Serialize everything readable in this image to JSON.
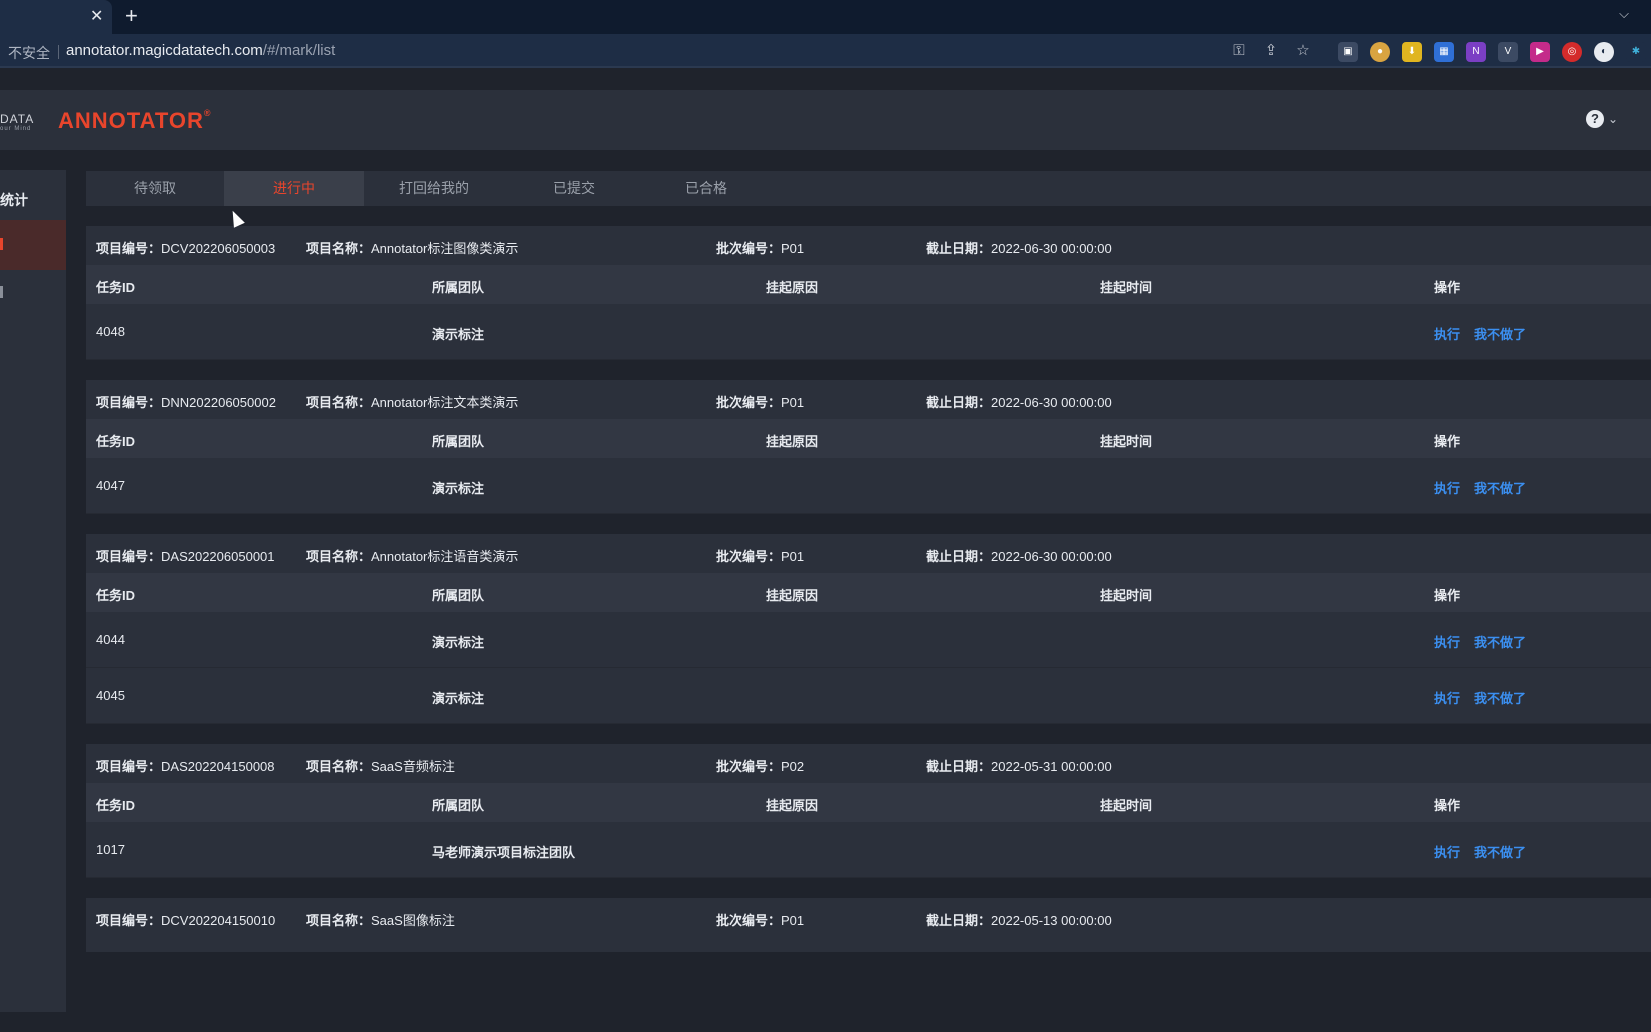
{
  "browser": {
    "insecure_label": "不安全",
    "url_host": "annotator.magicdatatech.com",
    "url_path": "/#/mark/list"
  },
  "header": {
    "logo_data": "DATA",
    "logo_sub": "our Mind",
    "logo_text": "ANNOTATOR",
    "logo_mark": "®",
    "help_label": "?"
  },
  "sidebar": {
    "stat_label": "统计"
  },
  "tabs": [
    {
      "label": "待领取"
    },
    {
      "label": "进行中"
    },
    {
      "label": "打回给我的"
    },
    {
      "label": "已提交"
    },
    {
      "label": "已合格"
    }
  ],
  "columns": [
    "任务ID",
    "所属团队",
    "挂起原因",
    "挂起时间",
    "操作"
  ],
  "actions": {
    "execute": "执行",
    "quit": "我不做了"
  },
  "projects": [
    {
      "code_label": "项目编号：",
      "code": "DCV202206050003",
      "name_label": "项目名称：",
      "name": "Annotator标注图像类演示",
      "batch_label": "批次编号：",
      "batch": "P01",
      "deadline_label": "截止日期：",
      "deadline": "2022-06-30 00:00:00",
      "rows": [
        {
          "id": "4048",
          "team": "演示标注"
        }
      ]
    },
    {
      "code_label": "项目编号：",
      "code": "DNN202206050002",
      "name_label": "项目名称：",
      "name": "Annotator标注文本类演示",
      "batch_label": "批次编号：",
      "batch": "P01",
      "deadline_label": "截止日期：",
      "deadline": "2022-06-30 00:00:00",
      "rows": [
        {
          "id": "4047",
          "team": "演示标注"
        }
      ]
    },
    {
      "code_label": "项目编号：",
      "code": "DAS202206050001",
      "name_label": "项目名称：",
      "name": "Annotator标注语音类演示",
      "batch_label": "批次编号：",
      "batch": "P01",
      "deadline_label": "截止日期：",
      "deadline": "2022-06-30 00:00:00",
      "rows": [
        {
          "id": "4044",
          "team": "演示标注"
        },
        {
          "id": "4045",
          "team": "演示标注"
        }
      ]
    },
    {
      "code_label": "项目编号：",
      "code": "DAS202204150008",
      "name_label": "项目名称：",
      "name": "SaaS音频标注",
      "batch_label": "批次编号：",
      "batch": "P02",
      "deadline_label": "截止日期：",
      "deadline": "2022-05-31 00:00:00",
      "rows": [
        {
          "id": "1017",
          "team": "马老师演示项目标注团队"
        }
      ]
    },
    {
      "code_label": "项目编号：",
      "code": "DCV202204150010",
      "name_label": "项目名称：",
      "name": "SaaS图像标注",
      "batch_label": "批次编号：",
      "batch": "P01",
      "deadline_label": "截止日期：",
      "deadline": "2022-05-13 00:00:00",
      "rows": []
    }
  ]
}
